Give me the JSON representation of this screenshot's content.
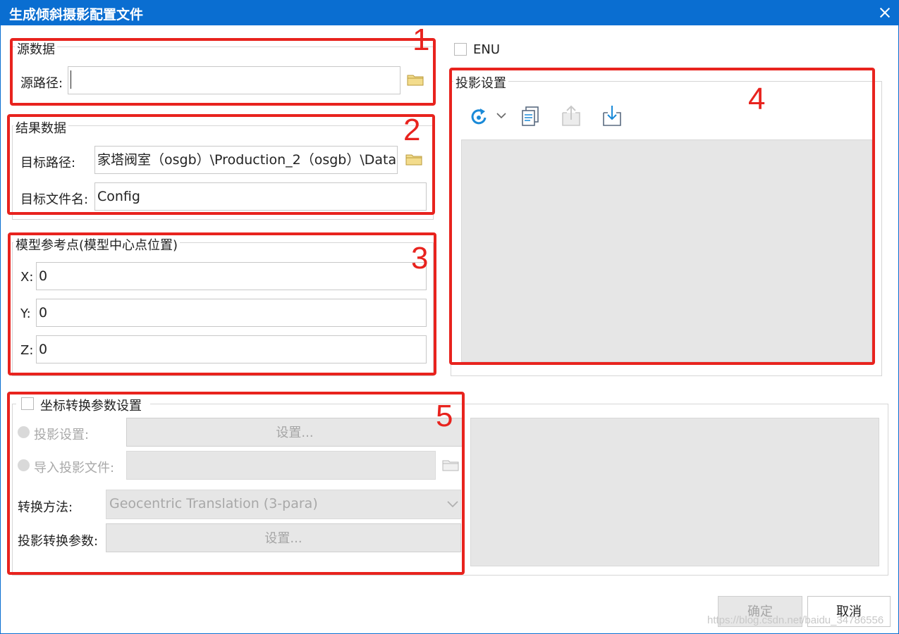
{
  "window": {
    "title": "生成倾斜摄影配置文件"
  },
  "source_data": {
    "group_label": "源数据",
    "path_label": "源路径:",
    "path_value": ""
  },
  "result_data": {
    "group_label": "结果数据",
    "target_path_label": "目标路径:",
    "target_path_value": "家塔阀室（osgb）\\Production_2（osgb）\\Data",
    "target_filename_label": "目标文件名:",
    "target_filename_value": "Config"
  },
  "model_ref": {
    "group_label": "模型参考点(模型中心点位置)",
    "x_label": "X:",
    "x_value": "0",
    "y_label": "Y:",
    "y_value": "0",
    "z_label": "Z:",
    "z_value": "0"
  },
  "enu": {
    "label": "ENU"
  },
  "projection": {
    "group_label": "投影设置"
  },
  "coord_transform": {
    "group_label": "坐标转换参数设置",
    "proj_setting_label": "投影设置:",
    "proj_setting_button": "设置...",
    "import_proj_label": "导入投影文件:",
    "method_label": "转换方法:",
    "method_value": "Geocentric Translation (3-para)",
    "params_label": "投影转换参数:",
    "params_button": "设置..."
  },
  "footer": {
    "ok_label": "确定",
    "cancel_label": "取消"
  },
  "annotations": {
    "n1": "1",
    "n2": "2",
    "n3": "3",
    "n4": "4",
    "n5": "5"
  },
  "watermark": "https://blog.csdn.net/baidu_34786556",
  "colors": {
    "title_bar": "#0a6ed1",
    "annotation_red": "#e8231e",
    "disabled_bg": "#e6e6e6"
  }
}
